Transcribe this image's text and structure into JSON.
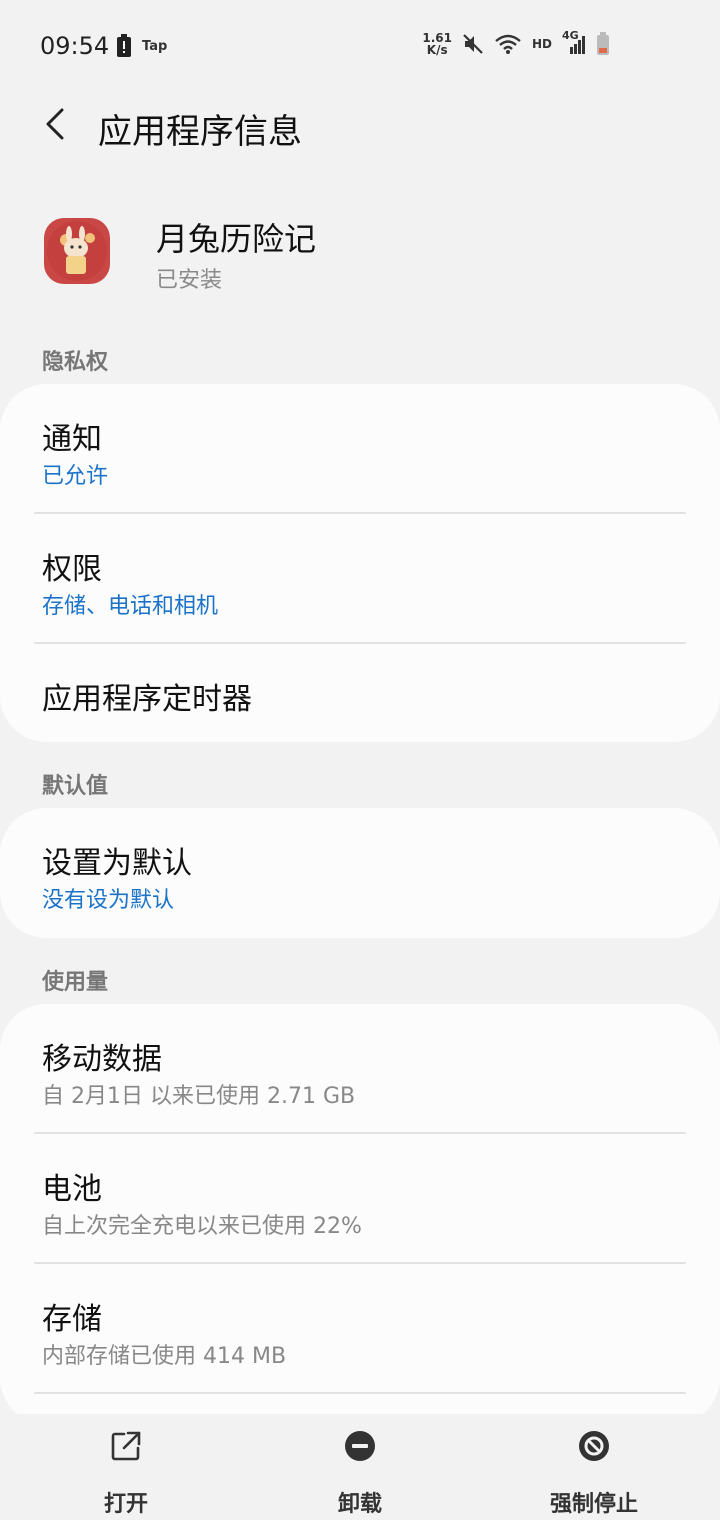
{
  "status_bar": {
    "time": "09:54",
    "tap_label": "Tap",
    "net_speed_value": "1.61",
    "net_speed_unit": "K/s",
    "hd_label": "HD",
    "network_label": "4G"
  },
  "header": {
    "title": "应用程序信息"
  },
  "app": {
    "name": "月兔历险记",
    "status": "已安装"
  },
  "sections": {
    "privacy": {
      "label": "隐私权",
      "items": [
        {
          "title": "通知",
          "subtitle": "已允许"
        },
        {
          "title": "权限",
          "subtitle": "存储、电话和相机"
        },
        {
          "title": "应用程序定时器",
          "subtitle": ""
        }
      ]
    },
    "defaults": {
      "label": "默认值",
      "items": [
        {
          "title": "设置为默认",
          "subtitle": "没有设为默认"
        }
      ]
    },
    "usage": {
      "label": "使用量",
      "items": [
        {
          "title": "移动数据",
          "subtitle": "自 2月1日 以来已使用 2.71 GB"
        },
        {
          "title": "电池",
          "subtitle": "自上次完全充电以来已使用 22%"
        },
        {
          "title": "存储",
          "subtitle": "内部存储已使用 414 MB"
        }
      ]
    }
  },
  "actions": {
    "open": "打开",
    "uninstall": "卸载",
    "force_stop": "强制停止"
  },
  "colors": {
    "accent_blue": "#1a73c9",
    "background": "#f2f2f2",
    "card": "#fcfcfc"
  }
}
